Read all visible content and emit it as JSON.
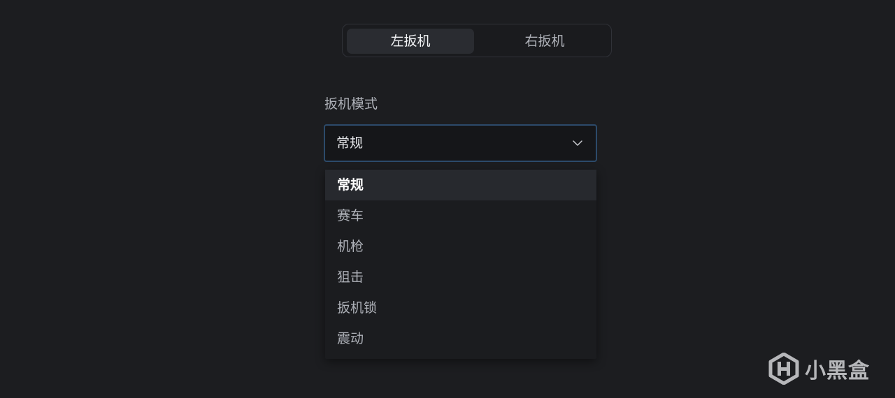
{
  "tabs": [
    {
      "label": "左扳机",
      "active": true
    },
    {
      "label": "右扳机",
      "active": false
    }
  ],
  "trigger_mode": {
    "label": "扳机模式",
    "selected_value": "常规",
    "options": [
      "常规",
      "赛车",
      "机枪",
      "狙击",
      "扳机锁",
      "震动"
    ]
  },
  "watermark": {
    "text": "小黑盒"
  },
  "colors": {
    "background": "#1c1d20",
    "select_border": "#2c4a6a",
    "active_tab": "#2a2c31",
    "highlight_option": "#27292e"
  }
}
